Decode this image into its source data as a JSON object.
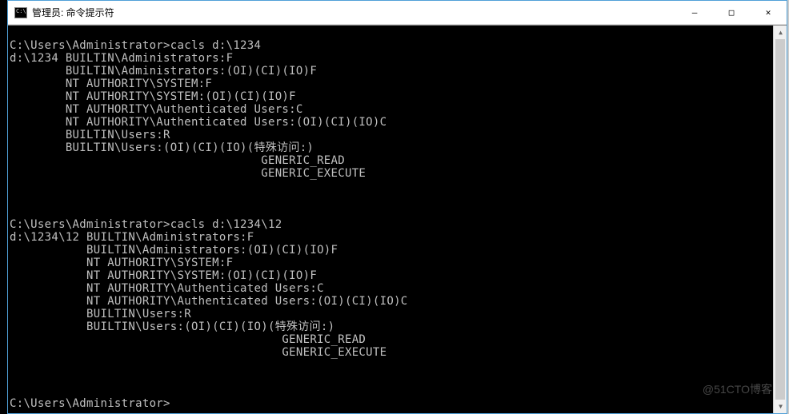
{
  "titlebar": {
    "title": "管理员: 命令提示符"
  },
  "console": {
    "lines": [
      "",
      "C:\\Users\\Administrator>cacls d:\\1234",
      "d:\\1234 BUILTIN\\Administrators:F",
      "        BUILTIN\\Administrators:(OI)(CI)(IO)F",
      "        NT AUTHORITY\\SYSTEM:F",
      "        NT AUTHORITY\\SYSTEM:(OI)(CI)(IO)F",
      "        NT AUTHORITY\\Authenticated Users:C",
      "        NT AUTHORITY\\Authenticated Users:(OI)(CI)(IO)C",
      "        BUILTIN\\Users:R",
      "        BUILTIN\\Users:(OI)(CI)(IO)(特殊访问:)",
      "                                    GENERIC_READ",
      "                                    GENERIC_EXECUTE",
      "",
      "",
      "",
      "C:\\Users\\Administrator>cacls d:\\1234\\12",
      "d:\\1234\\12 BUILTIN\\Administrators:F",
      "           BUILTIN\\Administrators:(OI)(CI)(IO)F",
      "           NT AUTHORITY\\SYSTEM:F",
      "           NT AUTHORITY\\SYSTEM:(OI)(CI)(IO)F",
      "           NT AUTHORITY\\Authenticated Users:C",
      "           NT AUTHORITY\\Authenticated Users:(OI)(CI)(IO)C",
      "           BUILTIN\\Users:R",
      "           BUILTIN\\Users:(OI)(CI)(IO)(特殊访问:)",
      "                                       GENERIC_READ",
      "                                       GENERIC_EXECUTE",
      "",
      "",
      "",
      "C:\\Users\\Administrator>"
    ]
  },
  "watermark": "@51CTO博客",
  "controls": {
    "minimize": "—",
    "maximize": "□",
    "close": "✕"
  }
}
